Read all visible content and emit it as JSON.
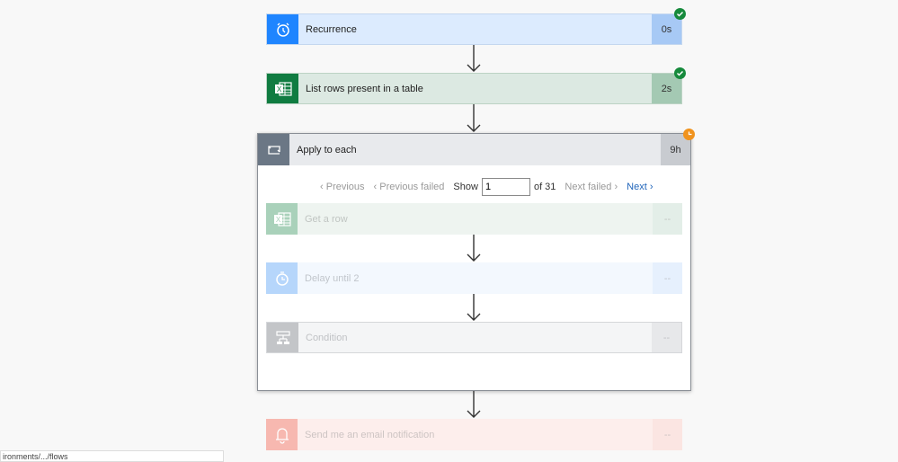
{
  "steps": {
    "recurrence": {
      "title": "Recurrence",
      "duration": "0s",
      "status": "succeeded"
    },
    "list_rows": {
      "title": "List rows present in a table",
      "duration": "2s",
      "status": "succeeded"
    },
    "apply_each": {
      "title": "Apply to each",
      "duration": "9h",
      "status": "running"
    },
    "get_row": {
      "title": "Get a row",
      "duration": "--"
    },
    "delay": {
      "title": "Delay until 2",
      "duration": "--"
    },
    "condition": {
      "title": "Condition",
      "duration": "--"
    },
    "email": {
      "title": "Send me an email notification",
      "duration": "--"
    }
  },
  "pager": {
    "previous": "Previous",
    "previous_failed": "Previous failed",
    "show": "Show",
    "value": "1",
    "of": "of 31",
    "next_failed": "Next failed",
    "next": "Next"
  },
  "status_bar": "ironments/.../flows",
  "colors": {
    "success": "#168a3c",
    "running": "#f0931e",
    "link": "#2266bb"
  }
}
